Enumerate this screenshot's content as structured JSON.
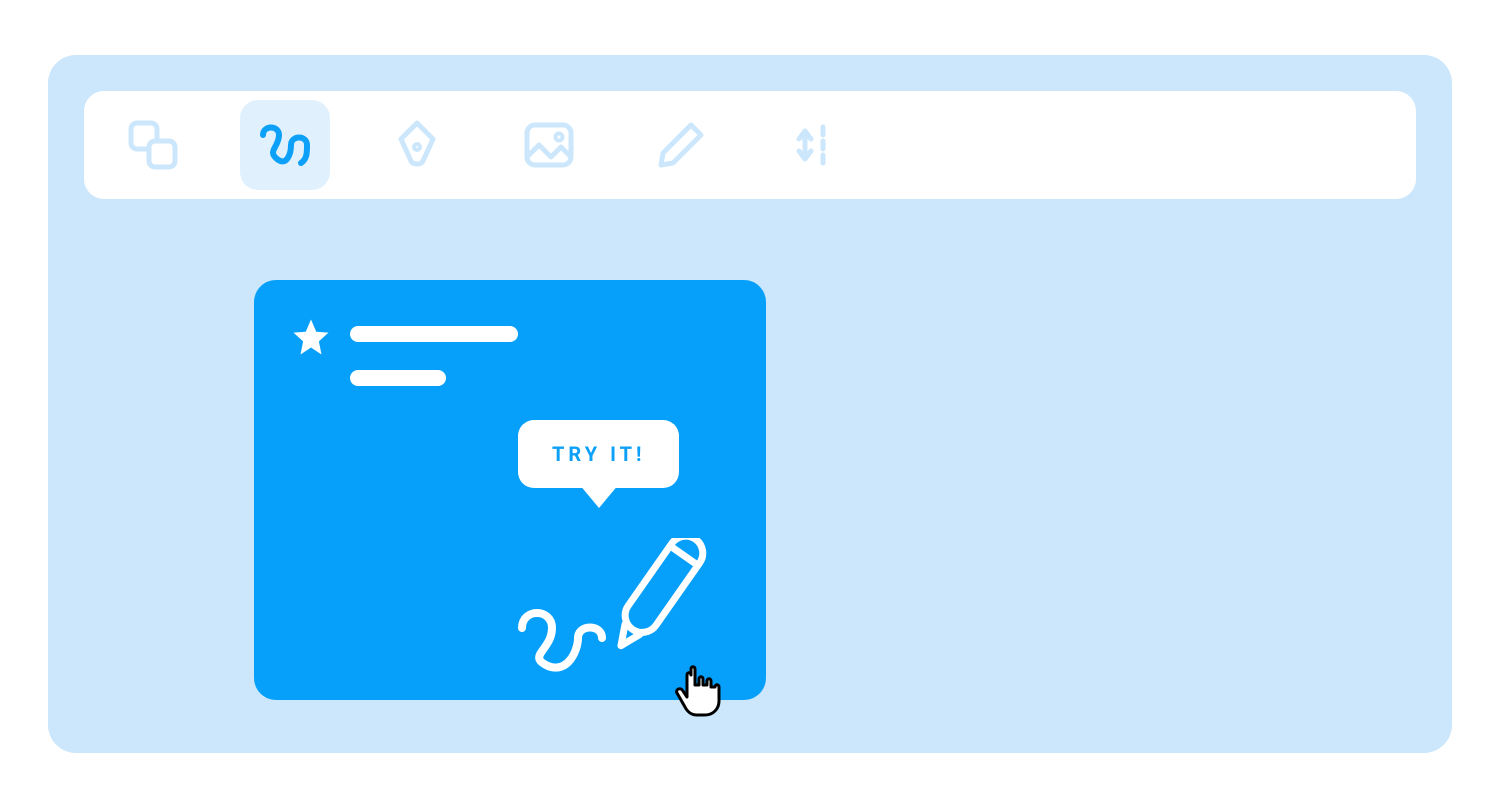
{
  "toolbar": {
    "tools": [
      {
        "name": "shapes-icon",
        "active": false
      },
      {
        "name": "squiggle-icon",
        "active": true
      },
      {
        "name": "pen-tool-icon",
        "active": false
      },
      {
        "name": "image-icon",
        "active": false
      },
      {
        "name": "pencil-icon",
        "active": false
      },
      {
        "name": "resize-vertical-icon",
        "active": false
      }
    ]
  },
  "card": {
    "tooltip_text": "TRY IT!"
  },
  "colors": {
    "canvas_bg": "#cce7fb",
    "card_bg": "#06a0fa",
    "accent": "#0ca0f8",
    "toolbar_bg": "#ffffff"
  }
}
